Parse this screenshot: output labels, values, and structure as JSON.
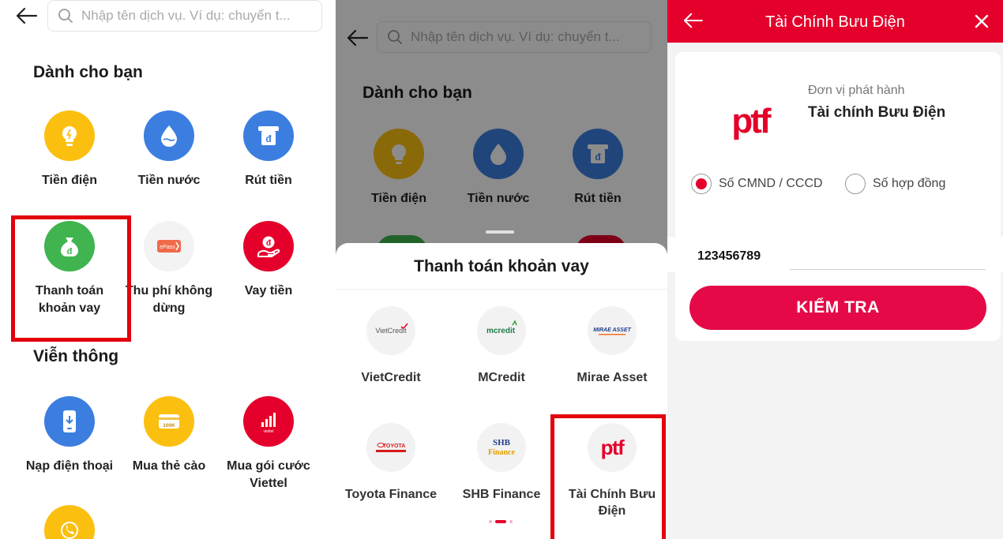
{
  "panel1": {
    "search_placeholder": "Nhập tên dịch vụ. Ví dụ: chuyển t...",
    "section_for_you": "Dành cho bạn",
    "services_for_you": [
      {
        "label": "Tiền điện",
        "icon": "lightbulb-icon",
        "color": "#fbbf10"
      },
      {
        "label": "Tiền nước",
        "icon": "water-drop-icon",
        "color": "#3b7ee0"
      },
      {
        "label": "Rút tiền",
        "icon": "atm-withdraw-icon",
        "color": "#3b7ee0"
      },
      {
        "label": "Thanh toán khoản vay",
        "icon": "money-bag-icon",
        "color": "#3fb44f"
      },
      {
        "label": "Thu phí không dừng",
        "icon": "epass-icon",
        "color": "#f06a4a",
        "logo_text": "ePass"
      },
      {
        "label": "Vay tiền",
        "icon": "hand-coin-icon",
        "color": "#e4002b"
      }
    ],
    "section_telecom": "Viễn thông",
    "services_telecom": [
      {
        "label": "Nạp điện thoại",
        "icon": "phone-topup-icon",
        "color": "#3b7ee0"
      },
      {
        "label": "Mua thẻ cào",
        "icon": "scratch-card-icon",
        "color": "#fbbf10",
        "logo_text": "100K"
      },
      {
        "label": "Mua gói cước Viettel",
        "icon": "viettel-signal-icon",
        "color": "#e4002b",
        "logo_text": "viettel"
      },
      {
        "label": "",
        "icon": "phone-call-icon",
        "color": "#fbbf10"
      }
    ]
  },
  "panel2": {
    "search_placeholder": "Nhập tên dịch vụ. Ví dụ: chuyển t...",
    "section_for_you": "Dành cho bạn",
    "services": [
      {
        "label": "Tiền điện",
        "icon": "lightbulb-icon",
        "color": "#fbbf10"
      },
      {
        "label": "Tiền nước",
        "icon": "water-drop-icon",
        "color": "#3b7ee0"
      },
      {
        "label": "Rút tiền",
        "icon": "atm-withdraw-icon",
        "color": "#3b7ee0"
      }
    ],
    "sheet_title": "Thanh toán khoản vay",
    "lenders": [
      {
        "label": "VietCredit",
        "logo_text": "VietCredit",
        "logo_color": "#555555"
      },
      {
        "label": "MCredit",
        "logo_text": "mcredit",
        "logo_color": "#1e7a46"
      },
      {
        "label": "Mirae Asset",
        "logo_text": "MIRAE ASSET",
        "logo_color": "#f26f21"
      },
      {
        "label": "Toyota Finance",
        "logo_text": "TOYOTA",
        "logo_color": "#d61c1c"
      },
      {
        "label": "SHB Finance",
        "logo_text": "SHB",
        "logo_subtext": "Finance",
        "logo_color": "#1f3c88"
      },
      {
        "label": "Tài Chính Bưu Điện",
        "logo_text": "ptf",
        "logo_color": "#e4002b"
      }
    ]
  },
  "panel3": {
    "title": "Tài Chính Bưu Điện",
    "issuer_label": "Đơn vị phát hành",
    "issuer_name": "Tài chính Bưu Điện",
    "logo_text": "ptf",
    "radio_options": [
      {
        "label": "Số CMND / CCCD",
        "selected": true
      },
      {
        "label": "Số hợp đồng",
        "selected": false
      }
    ],
    "input_value": "123456789",
    "check_button": "KIỂM TRA",
    "accent_color": "#e4002b"
  }
}
